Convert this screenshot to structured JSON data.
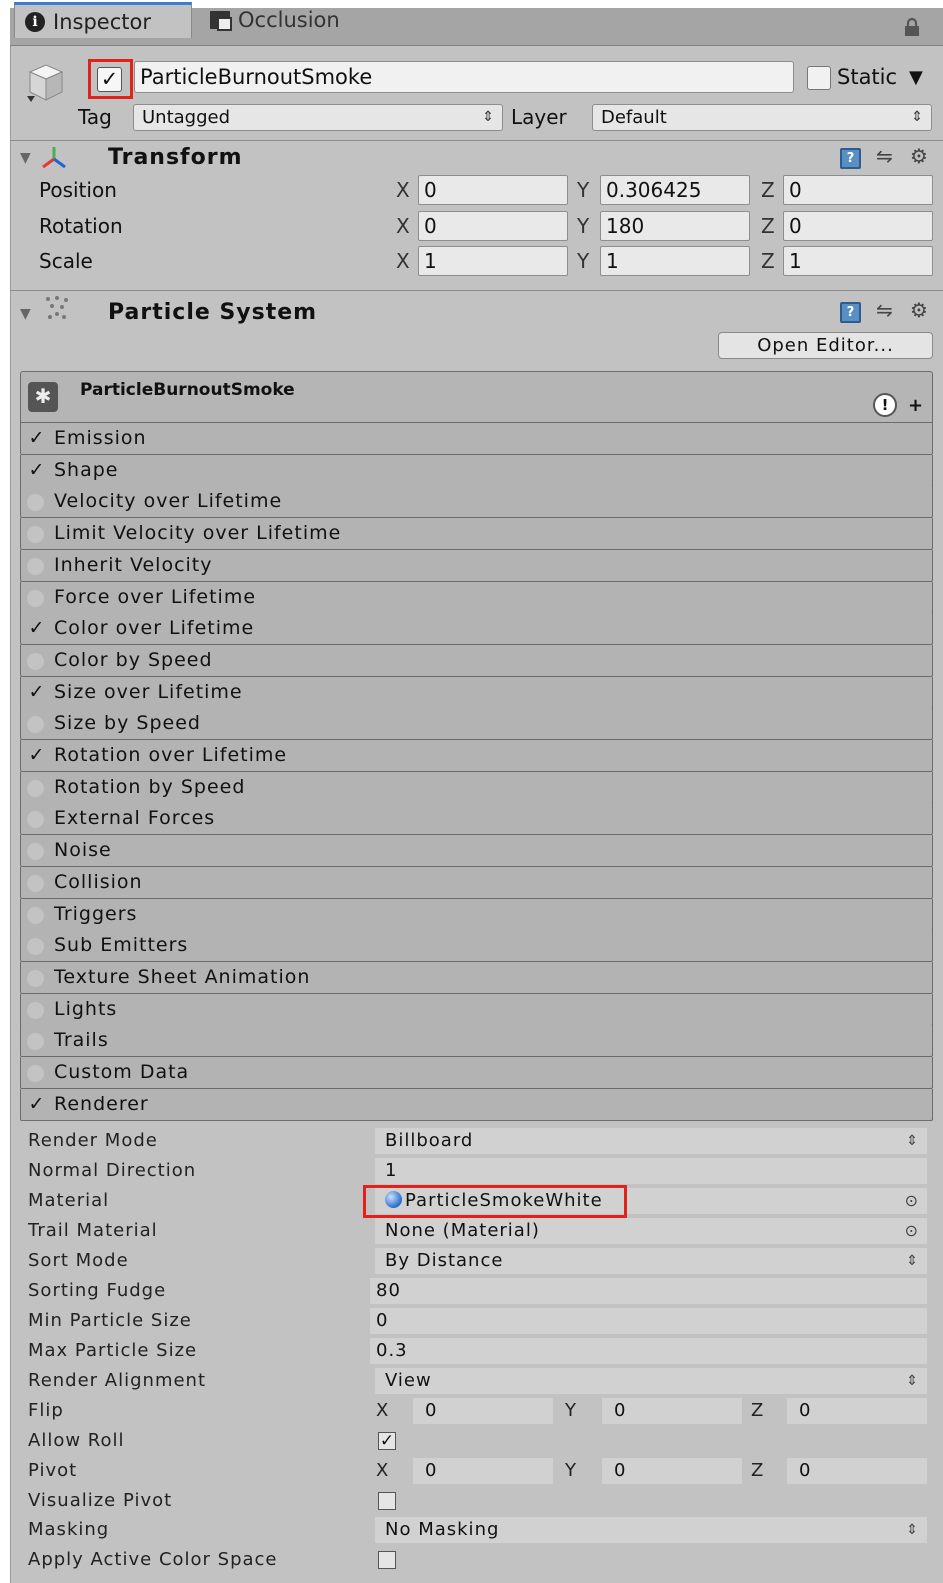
{
  "tabs": {
    "inspector": "Inspector",
    "occlusion": "Occlusion"
  },
  "header": {
    "object_name": "ParticleBurnoutSmoke",
    "static_label": "Static",
    "tag_label": "Tag",
    "tag_value": "Untagged",
    "layer_label": "Layer",
    "layer_value": "Default"
  },
  "transform": {
    "title": "Transform",
    "rows": [
      {
        "label": "Position",
        "x": "0",
        "y": "0.306425",
        "z": "0"
      },
      {
        "label": "Rotation",
        "x": "0",
        "y": "180",
        "z": "0"
      },
      {
        "label": "Scale",
        "x": "1",
        "y": "1",
        "z": "1"
      }
    ]
  },
  "particle_system": {
    "title": "Particle System",
    "open_editor": "Open Editor...",
    "system_name": "ParticleBurnoutSmoke",
    "modules": [
      {
        "label": "Emission",
        "enabled": true
      },
      {
        "label": "Shape",
        "enabled": true
      },
      {
        "label": "Velocity over Lifetime",
        "enabled": false
      },
      {
        "label": "Limit Velocity over Lifetime",
        "enabled": false
      },
      {
        "label": "Inherit Velocity",
        "enabled": false
      },
      {
        "label": "Force over Lifetime",
        "enabled": false
      },
      {
        "label": "Color over Lifetime",
        "enabled": true
      },
      {
        "label": "Color by Speed",
        "enabled": false
      },
      {
        "label": "Size over Lifetime",
        "enabled": true
      },
      {
        "label": "Size by Speed",
        "enabled": false
      },
      {
        "label": "Rotation over Lifetime",
        "enabled": true
      },
      {
        "label": "Rotation by Speed",
        "enabled": false
      },
      {
        "label": "External Forces",
        "enabled": false
      },
      {
        "label": "Noise",
        "enabled": false
      },
      {
        "label": "Collision",
        "enabled": false
      },
      {
        "label": "Triggers",
        "enabled": false
      },
      {
        "label": "Sub Emitters",
        "enabled": false
      },
      {
        "label": "Texture Sheet Animation",
        "enabled": false
      },
      {
        "label": "Lights",
        "enabled": false
      },
      {
        "label": "Trails",
        "enabled": false
      },
      {
        "label": "Custom Data",
        "enabled": false
      },
      {
        "label": "Renderer",
        "enabled": true
      }
    ]
  },
  "renderer": {
    "render_mode": {
      "label": "Render Mode",
      "value": "Billboard"
    },
    "normal_direction": {
      "label": "Normal Direction",
      "value": "1"
    },
    "material": {
      "label": "Material",
      "value": "ParticleSmokeWhite"
    },
    "trail_material": {
      "label": "Trail Material",
      "value": "None (Material)"
    },
    "sort_mode": {
      "label": "Sort Mode",
      "value": "By Distance"
    },
    "sorting_fudge": {
      "label": "Sorting Fudge",
      "value": "80"
    },
    "min_particle_size": {
      "label": "Min Particle Size",
      "value": "0"
    },
    "max_particle_size": {
      "label": "Max Particle Size",
      "value": "0.3"
    },
    "render_alignment": {
      "label": "Render Alignment",
      "value": "View"
    },
    "flip": {
      "label": "Flip",
      "x": "0",
      "y": "0",
      "z": "0"
    },
    "allow_roll": {
      "label": "Allow Roll",
      "checked": true
    },
    "pivot": {
      "label": "Pivot",
      "x": "0",
      "y": "0",
      "z": "0"
    },
    "visualize_pivot": {
      "label": "Visualize Pivot",
      "checked": false
    },
    "masking": {
      "label": "Masking",
      "value": "No Masking"
    },
    "apply_active_color_space": {
      "label": "Apply Active Color Space",
      "checked": false
    }
  },
  "axis_labels": {
    "x": "X",
    "y": "Y",
    "z": "Z"
  }
}
